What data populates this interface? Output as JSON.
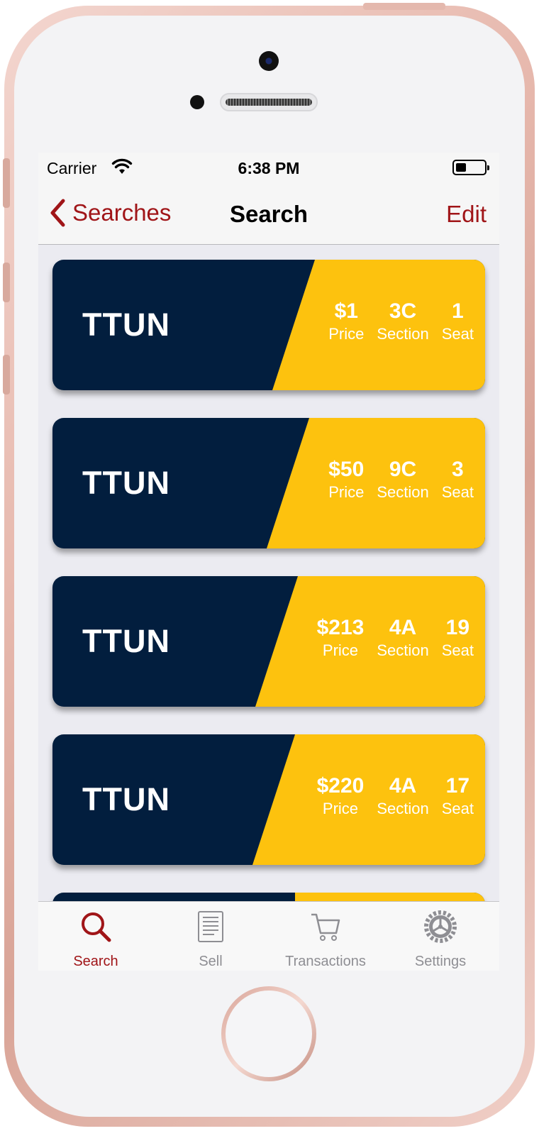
{
  "status": {
    "carrier": "Carrier",
    "time": "6:38 PM"
  },
  "nav": {
    "back_label": "Searches",
    "title": "Search",
    "edit_label": "Edit"
  },
  "labels": {
    "price": "Price",
    "section": "Section",
    "seat": "Seat"
  },
  "colors": {
    "navy": "#021E3E",
    "gold": "#FDC20E",
    "accent": "#A01518"
  },
  "listings": [
    {
      "team": "TTUN",
      "price": "$1",
      "section": "3C",
      "seat": "1"
    },
    {
      "team": "TTUN",
      "price": "$50",
      "section": "9C",
      "seat": "3"
    },
    {
      "team": "TTUN",
      "price": "$213",
      "section": "4A",
      "seat": "19"
    },
    {
      "team": "TTUN",
      "price": "$220",
      "section": "4A",
      "seat": "17"
    }
  ],
  "tabs": [
    {
      "label": "Search",
      "icon": "search-icon",
      "active": true
    },
    {
      "label": "Sell",
      "icon": "document-icon",
      "active": false
    },
    {
      "label": "Transactions",
      "icon": "cart-icon",
      "active": false
    },
    {
      "label": "Settings",
      "icon": "gear-icon",
      "active": false
    }
  ]
}
